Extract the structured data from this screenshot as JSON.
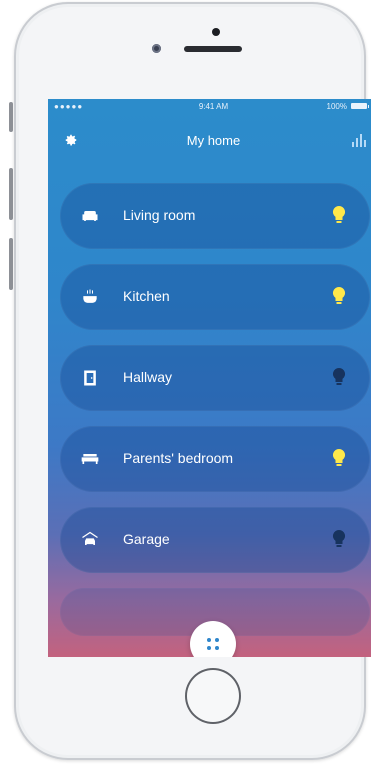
{
  "status_bar": {
    "signal": "●●●●● ",
    "time": "9:41 AM",
    "battery": "100%"
  },
  "header": {
    "title": "My home",
    "left_icon": "gear-icon",
    "right_icon": "bar-chart-icon"
  },
  "rooms": [
    {
      "label": "Living room",
      "icon": "sofa-icon",
      "light_on": true
    },
    {
      "label": "Kitchen",
      "icon": "pot-icon",
      "light_on": true
    },
    {
      "label": "Hallway",
      "icon": "door-icon",
      "light_on": false
    },
    {
      "label": "Parents' bedroom",
      "icon": "bed-icon",
      "light_on": true
    },
    {
      "label": "Garage",
      "icon": "car-icon",
      "light_on": false
    }
  ],
  "fab_icon": "grid-dots-icon",
  "colors": {
    "accent": "#2f86cb",
    "bulb_on": "#ffe84a",
    "bulb_off": "#17335e"
  }
}
